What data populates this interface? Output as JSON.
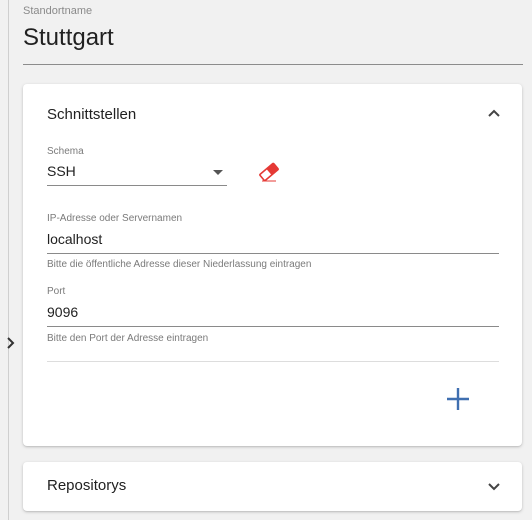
{
  "location": {
    "label": "Standortname",
    "value": "Stuttgart"
  },
  "interfaces": {
    "title": "Schnittstellen",
    "expanded": true,
    "schema": {
      "label": "Schema",
      "value": "SSH"
    },
    "host": {
      "label": "IP-Adresse oder Servernamen",
      "value": "localhost",
      "hint": "Bitte die öffentliche Adresse dieser Niederlassung eintragen"
    },
    "port": {
      "label": "Port",
      "value": "9096",
      "hint": "Bitte den Port der Adresse eintragen"
    },
    "icons": {
      "remove": "eraser-icon",
      "add": "plus-icon",
      "collapse": "chevron-up-icon"
    }
  },
  "repositories": {
    "title": "Repositorys",
    "expanded": false,
    "icon": "chevron-down-icon"
  },
  "colors": {
    "accent": "#3f6fb0",
    "danger": "#e53935",
    "background": "#f1f1f1"
  }
}
